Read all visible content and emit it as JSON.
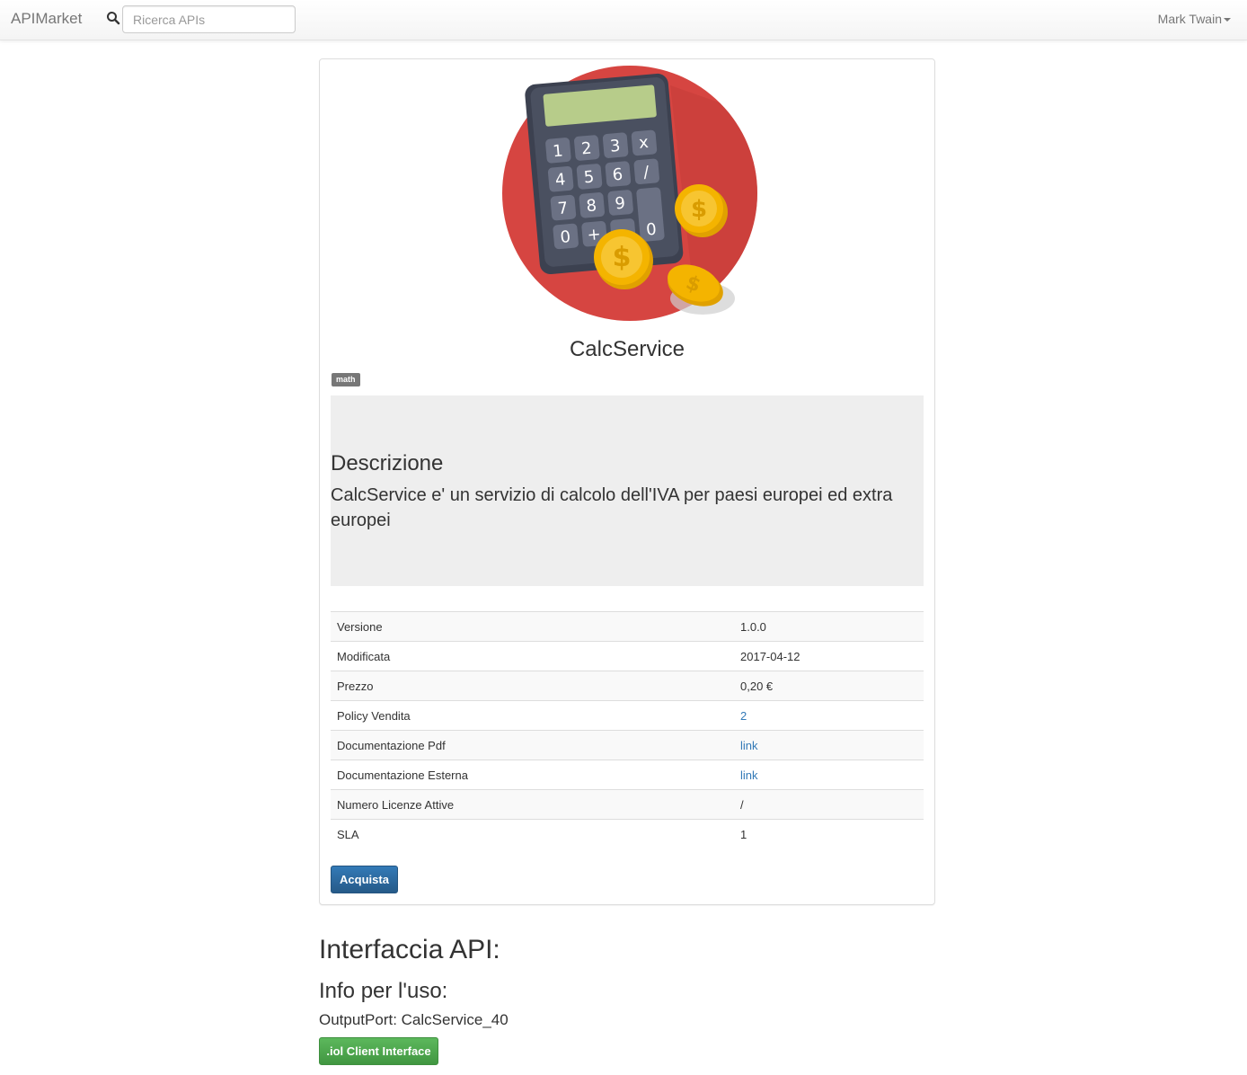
{
  "navbar": {
    "brand": "APIMarket",
    "search_placeholder": "Ricerca APIs",
    "search_icon": "magnifier-icon",
    "user_name": "Mark Twain"
  },
  "api": {
    "title": "CalcService",
    "tag": "math",
    "description_heading": "Descrizione",
    "description_text": "CalcService e' un servizio di calcolo dell'IVA per paesi europei ed extra europei",
    "image": "calculator-with-coins-illustration",
    "details": [
      {
        "label": "Versione",
        "value": "1.0.0",
        "link": false
      },
      {
        "label": "Modificata",
        "value": "2017-04-12",
        "link": false
      },
      {
        "label": "Prezzo",
        "value": "0,20 €",
        "link": false
      },
      {
        "label": "Policy Vendita",
        "value": "2",
        "link": true
      },
      {
        "label": "Documentazione Pdf",
        "value": "link",
        "link": true
      },
      {
        "label": "Documentazione Esterna",
        "value": "link",
        "link": true
      },
      {
        "label": "Numero Licenze Attive",
        "value": "/",
        "link": false
      },
      {
        "label": "SLA",
        "value": "1",
        "link": false
      }
    ],
    "buy_button": "Acquista"
  },
  "interface": {
    "heading": "Interfaccia API:",
    "usage_heading": "Info per l'uso:",
    "output_port": "OutputPort: CalcService_40",
    "client_button": ".iol Client Interface"
  },
  "colors": {
    "primary": "#337ab7",
    "success": "#5cb85c",
    "hero_circle": "#d64541",
    "coin": "#f4b400"
  }
}
